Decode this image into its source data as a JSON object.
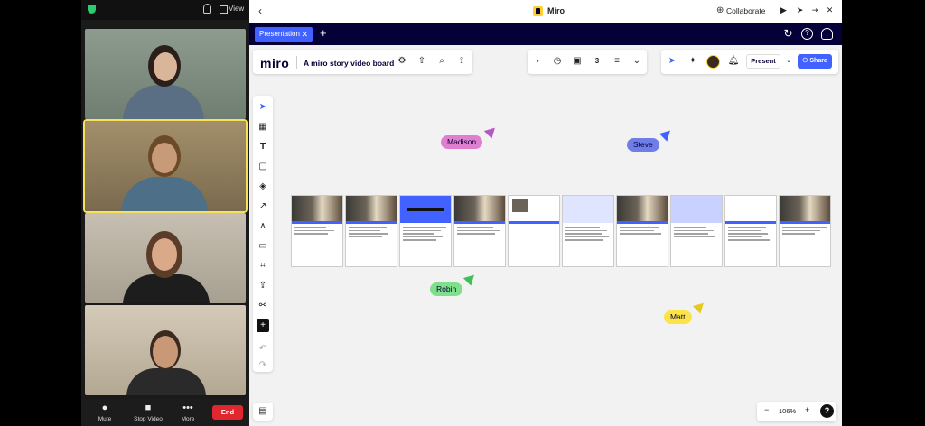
{
  "zoom": {
    "view_label": "View",
    "controls": [
      {
        "label": "Mute",
        "icon": "mic-icon"
      },
      {
        "label": "Stop Video",
        "icon": "video-icon"
      },
      {
        "label": "More",
        "icon": "more-icon"
      }
    ],
    "end_label": "End",
    "participants": [
      {
        "bg": "#7b8a7f",
        "skin": "#d9b59a",
        "hair": "#2a1f1a",
        "shirt": "#5a6f84"
      },
      {
        "bg": "#8c7a5c",
        "skin": "#c79a78",
        "hair": "#6b4a2a",
        "shirt": "#4d6f88"
      },
      {
        "bg": "#b9b1a2",
        "skin": "#d9a989",
        "hair": "#5b3c28",
        "shirt": "#1d1d1d"
      },
      {
        "bg": "#c3b9a7",
        "skin": "#c99877",
        "hair": "#3a2a20",
        "shirt": "#2a2a2a"
      }
    ]
  },
  "miro": {
    "window_title": "Miro",
    "collaborate_label": "Collaborate",
    "tab_label": "Presentation",
    "logo_text": "miro",
    "board_name": "A miro story video board",
    "present_label": "Present",
    "share_label": "Share",
    "zoom_level": "106%",
    "accent": "#4262ff",
    "frames": [
      {
        "thumb": "photo"
      },
      {
        "thumb": "photo"
      },
      {
        "thumb": "diagram"
      },
      {
        "thumb": "photo"
      },
      {
        "thumb": "photo-small"
      },
      {
        "thumb": "text"
      },
      {
        "thumb": "photo"
      },
      {
        "thumb": "slide"
      },
      {
        "thumb": "screens"
      },
      {
        "thumb": "photo"
      }
    ],
    "cursors": [
      {
        "name": "Madison",
        "color": "#e07fd0",
        "arrow": "#b455c9"
      },
      {
        "name": "Steve",
        "color": "#6f7de8",
        "arrow": "#4262ff"
      },
      {
        "name": "Robin",
        "color": "#7ee08a",
        "arrow": "#3fbf55"
      },
      {
        "name": "Matt",
        "color": "#fbe34a",
        "arrow": "#e8c81e"
      }
    ]
  }
}
